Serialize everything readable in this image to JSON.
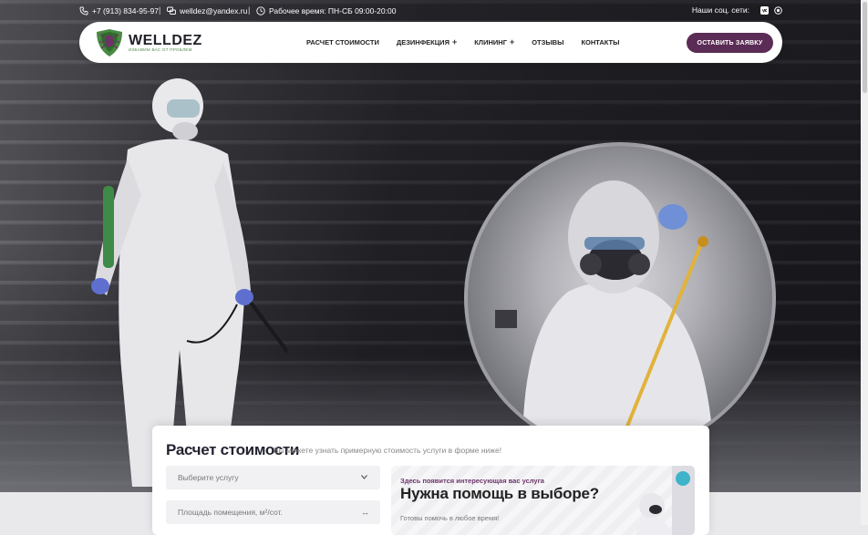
{
  "topbar": {
    "phone": "+7 (913) 834-95-97",
    "email": "welldez@yandex.ru",
    "hours": "Рабочее время: ПН-СБ 09:00-20:00",
    "social_label": "Наши соц. сети:",
    "separator": "|"
  },
  "nav": {
    "logo_name": "WELLDEZ",
    "logo_tagline": "ИЗБАВИМ ВАС ОТ ПРОБЛЕМ",
    "menu": [
      {
        "label": "Расчет стоимости"
      },
      {
        "label": "Дезинфекция",
        "plus": "+"
      },
      {
        "label": "Клининг",
        "plus": "+"
      },
      {
        "label": "Отзывы"
      },
      {
        "label": "Контакты"
      }
    ],
    "cta_label": "ОСТАВИТЬ ЗАЯВКУ"
  },
  "calculator": {
    "title": "Расчет стоимости",
    "subtitle": "Вы можете узнать примерную стоимость услуги в форме ниже!",
    "service_select": "Выберите услугу",
    "area_placeholder": "Площадь помещения, м²/сот.",
    "area_suffix": "↔"
  },
  "help_card": {
    "label": "Здесь появится интересующая вас услуга",
    "title": "Нужна помощь в выборе?",
    "note": "Готовы помочь в любое время!"
  },
  "colors": {
    "accent": "#5b2c56",
    "logo_green": "#4a8a45"
  }
}
